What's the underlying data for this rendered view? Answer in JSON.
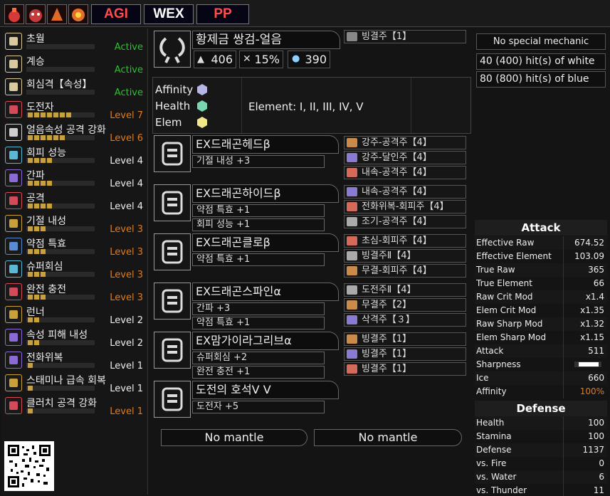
{
  "top_bar": {
    "icons": [
      "monster-icon-1",
      "monster-icon-2",
      "monster-icon-3",
      "monster-icon-4"
    ],
    "buttons": [
      "AGI",
      "WEX",
      "PP"
    ]
  },
  "skills": [
    {
      "name": "초월",
      "level": "Active",
      "level_color": "#2fbf2f",
      "pips": 0,
      "icon": "book-icon"
    },
    {
      "name": "계승",
      "level": "Active",
      "level_color": "#2fbf2f",
      "pips": 0,
      "icon": "book-icon"
    },
    {
      "name": "회심격【속성】",
      "level": "Active",
      "level_color": "#2fbf2f",
      "pips": 0,
      "icon": "book-icon"
    },
    {
      "name": "도전자",
      "level": "Level 7",
      "level_color": "#e07a1e",
      "pips": 7,
      "icon": "skill-icon-red"
    },
    {
      "name": "얼음속성 공격 강화",
      "level": "Level 6",
      "level_color": "#e07a1e",
      "pips": 6,
      "icon": "skill-icon-white"
    },
    {
      "name": "회피 성능",
      "level": "Level 4",
      "level_color": "#eeeeee",
      "pips": 4,
      "icon": "skill-icon-cyan"
    },
    {
      "name": "간파",
      "level": "Level 4",
      "level_color": "#eeeeee",
      "pips": 4,
      "icon": "skill-icon-purple"
    },
    {
      "name": "공격",
      "level": "Level 4",
      "level_color": "#eeeeee",
      "pips": 4,
      "icon": "skill-icon-red"
    },
    {
      "name": "기절 내성",
      "level": "Level 3",
      "level_color": "#e07a1e",
      "pips": 3,
      "icon": "skill-icon-gold"
    },
    {
      "name": "약점 특효",
      "level": "Level 3",
      "level_color": "#e07a1e",
      "pips": 3,
      "icon": "skill-icon-blue"
    },
    {
      "name": "슈퍼회심",
      "level": "Level 3",
      "level_color": "#e07a1e",
      "pips": 3,
      "icon": "skill-icon-cyan"
    },
    {
      "name": "완전 충전",
      "level": "Level 3",
      "level_color": "#e07a1e",
      "pips": 3,
      "icon": "skill-icon-red"
    },
    {
      "name": "런너",
      "level": "Level 2",
      "level_color": "#eeeeee",
      "pips": 2,
      "icon": "skill-icon-gold"
    },
    {
      "name": "속성 피해 내성",
      "level": "Level 2",
      "level_color": "#eeeeee",
      "pips": 2,
      "icon": "skill-icon-purple"
    },
    {
      "name": "전화위복",
      "level": "Level 1",
      "level_color": "#eeeeee",
      "pips": 1,
      "icon": "skill-icon-purple"
    },
    {
      "name": "스태미나 급속 회복",
      "level": "Level 1",
      "level_color": "#eeeeee",
      "pips": 1,
      "icon": "skill-icon-gold"
    },
    {
      "name": "클러치 공격 강화",
      "level": "Level 1",
      "level_color": "#e07a1e",
      "pips": 1,
      "icon": "skill-icon-red"
    }
  ],
  "weapon": {
    "name": "황제금 쌍검-얼음",
    "attack": "406",
    "affinity": "15%",
    "element": "390",
    "deco": "빙결주【1】",
    "labels": [
      "Affinity",
      "Health",
      "Elem"
    ],
    "element_text": "Element: I, II, III, IV, V"
  },
  "armor": [
    {
      "name": "EX드래곤헤드β",
      "skills": [
        "기절 내성 +3"
      ],
      "decos": [
        "강주-공격주【4】",
        "강주-달인주【4】",
        "내속-공격주【4】"
      ],
      "icon": "helmet-icon"
    },
    {
      "name": "EX드래곤하이드β",
      "skills": [
        "약점 특효 +1",
        "회피 성능 +1"
      ],
      "decos": [
        "내속-공격주【4】",
        "전화위복-회피주【4】",
        "조기-공격주【4】"
      ],
      "icon": "chest-icon"
    },
    {
      "name": "EX드래곤클로β",
      "skills": [
        "약점 특효 +1"
      ],
      "decos": [
        "초심-회피주【4】",
        "빙결주Ⅱ【4】",
        "무결-회피주【4】"
      ],
      "icon": "arm-icon"
    },
    {
      "name": "EX드래곤스파인α",
      "skills": [
        "간파 +3",
        "약점 특효 +1"
      ],
      "decos": [
        "도전주Ⅱ【4】",
        "무결주【2】",
        "삭격주【３】"
      ],
      "icon": "waist-icon"
    },
    {
      "name": "EX맘가이라그리브α",
      "skills": [
        "슈퍼회심 +2",
        "완전 충전 +1"
      ],
      "decos": [
        "빙결주【1】",
        "빙결주【1】",
        "빙결주【1】"
      ],
      "icon": "legs-icon"
    },
    {
      "name": "도전의 호석Ⅴ Ⅴ",
      "skills": [
        "도전자 +5"
      ],
      "decos": [],
      "icon": "charm-icon"
    }
  ],
  "mantles": [
    "No mantle",
    "No mantle"
  ],
  "info": {
    "mechanic": "No special mechanic",
    "white_hits": "40 (400) hit(s) of white",
    "blue_hits": "80 (800) hit(s) of blue"
  },
  "attack_section": {
    "title": "Attack",
    "rows": [
      {
        "k": "Effective Raw",
        "v": "674.52"
      },
      {
        "k": "Effective Element",
        "v": "103.09"
      },
      {
        "k": "True Raw",
        "v": "365"
      },
      {
        "k": "True Element",
        "v": "66"
      },
      {
        "k": "Raw Crit Mod",
        "v": "x1.4"
      },
      {
        "k": "Elem Crit Mod",
        "v": "x1.35"
      },
      {
        "k": "Raw Sharp Mod",
        "v": "x1.32"
      },
      {
        "k": "Elem Sharp Mod",
        "v": "x1.15"
      },
      {
        "k": "Attack",
        "v": "511"
      },
      {
        "k": "Sharpness",
        "v": ""
      },
      {
        "k": "Ice",
        "v": "660"
      },
      {
        "k": "Affinity",
        "v": "100%"
      }
    ]
  },
  "defense_section": {
    "title": "Defense",
    "rows": [
      {
        "k": "Health",
        "v": "100"
      },
      {
        "k": "Stamina",
        "v": "100"
      },
      {
        "k": "Defense",
        "v": "1137"
      },
      {
        "k": "vs. Fire",
        "v": "0"
      },
      {
        "k": "vs. Water",
        "v": "6"
      },
      {
        "k": "vs. Thunder",
        "v": "11"
      }
    ]
  },
  "colors": {
    "affinity_accent": "#e07a1e",
    "active": "#2fbf2f",
    "level_orange": "#e07a1e"
  }
}
